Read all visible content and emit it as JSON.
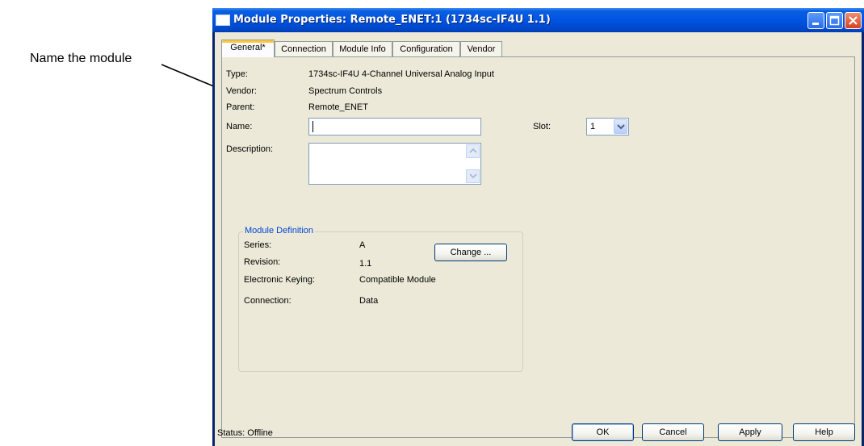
{
  "annotation": {
    "callout": "Name the module"
  },
  "window": {
    "title": "Module Properties: Remote_ENET:1 (1734sc-IF4U 1.1)",
    "controls": {
      "minimize": "minimize-icon",
      "maximize": "maximize-icon",
      "close": "close-icon"
    }
  },
  "tabs": [
    {
      "label": "General*",
      "active": true
    },
    {
      "label": "Connection",
      "active": false
    },
    {
      "label": "Module Info",
      "active": false
    },
    {
      "label": "Configuration",
      "active": false
    },
    {
      "label": "Vendor",
      "active": false
    }
  ],
  "general": {
    "type_label": "Type:",
    "type_value": "1734sc-IF4U 4-Channel Universal Analog Input",
    "vendor_label": "Vendor:",
    "vendor_value": "Spectrum Controls",
    "parent_label": "Parent:",
    "parent_value": "Remote_ENET",
    "name_label": "Name:",
    "name_value": "",
    "description_label": "Description:",
    "description_value": "",
    "slot_label": "Slot:",
    "slot_value": "1"
  },
  "module_definition": {
    "legend": "Module Definition",
    "series_label": "Series:",
    "series_value": "A",
    "revision_label": "Revision:",
    "revision_value": "1.1",
    "keying_label": "Electronic Keying:",
    "keying_value": "Compatible Module",
    "connection_label": "Connection:",
    "connection_value": "Data",
    "change_button": "Change ..."
  },
  "footer": {
    "status": "Status:  Offline",
    "ok": "OK",
    "cancel": "Cancel",
    "apply": "Apply",
    "help": "Help"
  },
  "colors": {
    "titlebar": "#0054e3",
    "dialog_face": "#ece9d8",
    "group_legend": "#0046d5",
    "active_tab_accent": "#ffc83c"
  }
}
